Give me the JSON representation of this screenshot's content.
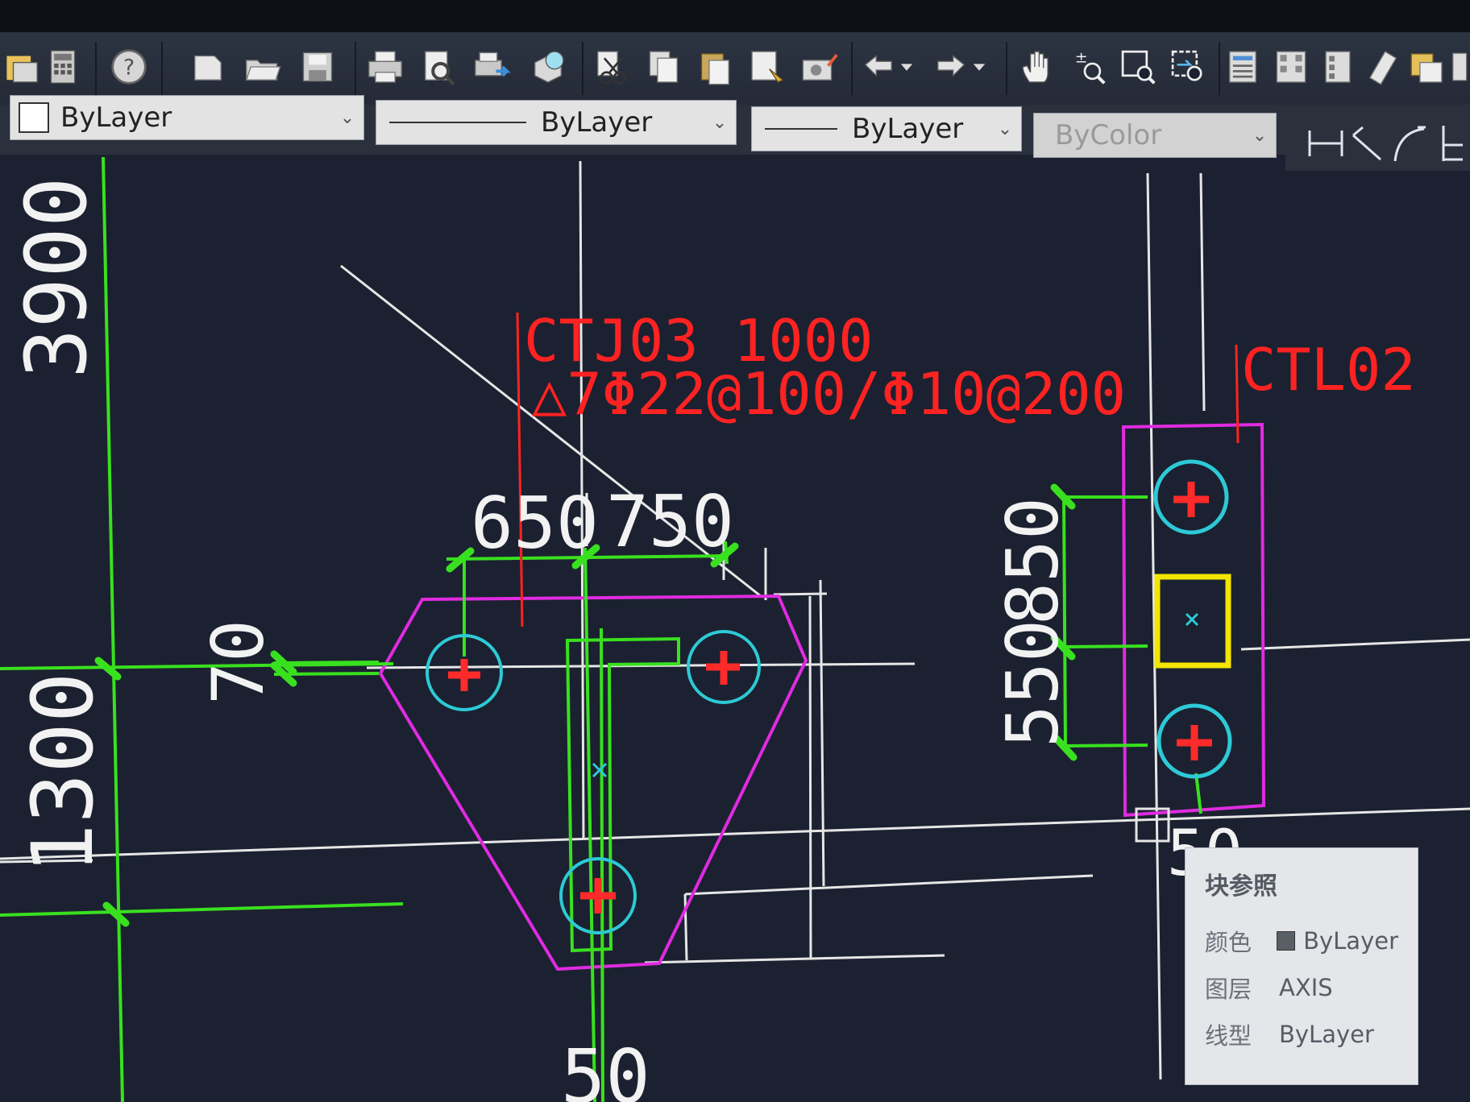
{
  "properties": {
    "color": "ByLayer",
    "linetype": "ByLayer",
    "lineweight": "ByLayer",
    "plotstyle": "ByColor"
  },
  "toolbar_icons": [
    "layer-icon",
    "calculator-icon",
    "help-icon",
    "new-icon",
    "open-icon",
    "save-icon",
    "print-icon",
    "print-preview-icon",
    "publish-icon",
    "render-icon",
    "cut-icon",
    "copy-icon",
    "paste-icon",
    "match-properties-icon",
    "block-editor-icon",
    "undo-icon",
    "redo-icon",
    "pan-icon",
    "zoom-realtime-icon",
    "zoom-window-icon",
    "zoom-previous-icon",
    "properties-icon",
    "design-center-icon",
    "tool-palettes-icon",
    "sheet-set-icon",
    "markup-icon",
    "calc-icon"
  ],
  "drawing": {
    "dimensions": {
      "left_top": "3900",
      "left_bottom": "1300",
      "d650": "650",
      "d750": "750",
      "d70": "70",
      "d550": "550",
      "d850": "850",
      "d50_bottom": "50",
      "d50_right": "50"
    },
    "labels": {
      "ctj_name": "CTJ03 1000",
      "ctj_rebar": "△7Φ22@100/Φ10@200",
      "ctl_name": "CTL02"
    },
    "colors": {
      "background": "#1b2130",
      "dimension": "#39e01f",
      "pile_cap": "#e02be0",
      "pile_circle": "#2ec9d6",
      "text_red": "#ff2222",
      "column": "#f2e600",
      "grid": "#e6e6e6"
    }
  },
  "tooltip": {
    "title": "块参照",
    "color_label": "颜色",
    "color_value": "ByLayer",
    "layer_label": "图层",
    "layer_value": "AXIS",
    "linetype_label": "线型",
    "linetype_value": "ByLayer"
  }
}
